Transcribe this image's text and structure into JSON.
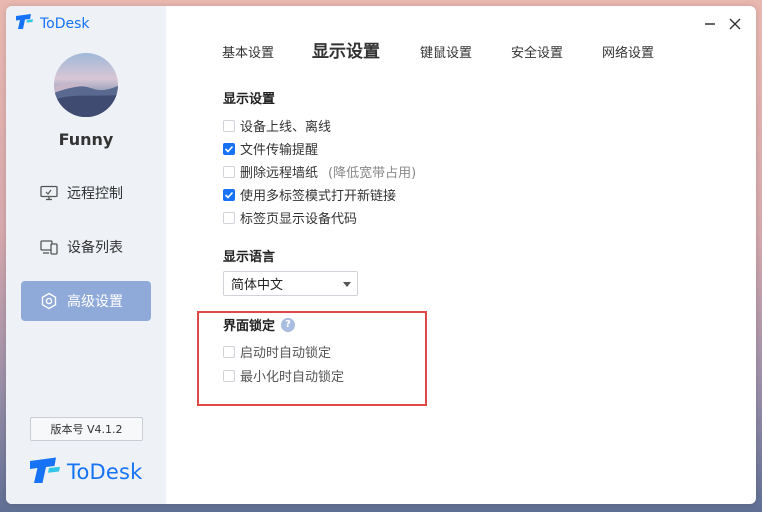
{
  "app": {
    "title": "ToDesk"
  },
  "sidebar": {
    "username": "Funny",
    "nav": [
      {
        "label": "远程控制",
        "icon": "monitor-icon"
      },
      {
        "label": "设备列表",
        "icon": "devices-icon"
      },
      {
        "label": "高级设置",
        "icon": "settings-icon",
        "active": true
      }
    ],
    "version": "版本号 V4.1.2",
    "brand": "ToDesk"
  },
  "tabs": [
    {
      "label": "基本设置",
      "active": false
    },
    {
      "label": "显示设置",
      "active": true
    },
    {
      "label": "键鼠设置",
      "active": false
    },
    {
      "label": "安全设置",
      "active": false
    },
    {
      "label": "网络设置",
      "active": false
    }
  ],
  "display": {
    "title": "显示设置",
    "options": [
      {
        "label": "设备上线、离线",
        "checked": false,
        "note": ""
      },
      {
        "label": "文件传输提醒",
        "checked": true,
        "note": ""
      },
      {
        "label": "删除远程墙纸",
        "checked": false,
        "note": "(降低宽带占用)"
      },
      {
        "label": "使用多标签模式打开新链接",
        "checked": true,
        "note": ""
      },
      {
        "label": "标签页显示设备代码",
        "checked": false,
        "note": ""
      }
    ]
  },
  "language": {
    "title": "显示语言",
    "selected": "简体中文"
  },
  "lock": {
    "title": "界面锁定",
    "help": "?",
    "options": [
      {
        "label": "启动时自动锁定",
        "checked": false
      },
      {
        "label": "最小化时自动锁定",
        "checked": false
      }
    ]
  },
  "colors": {
    "accent": "#1673f5",
    "active_nav": "#8fa9d9",
    "highlight": "#e04747"
  }
}
